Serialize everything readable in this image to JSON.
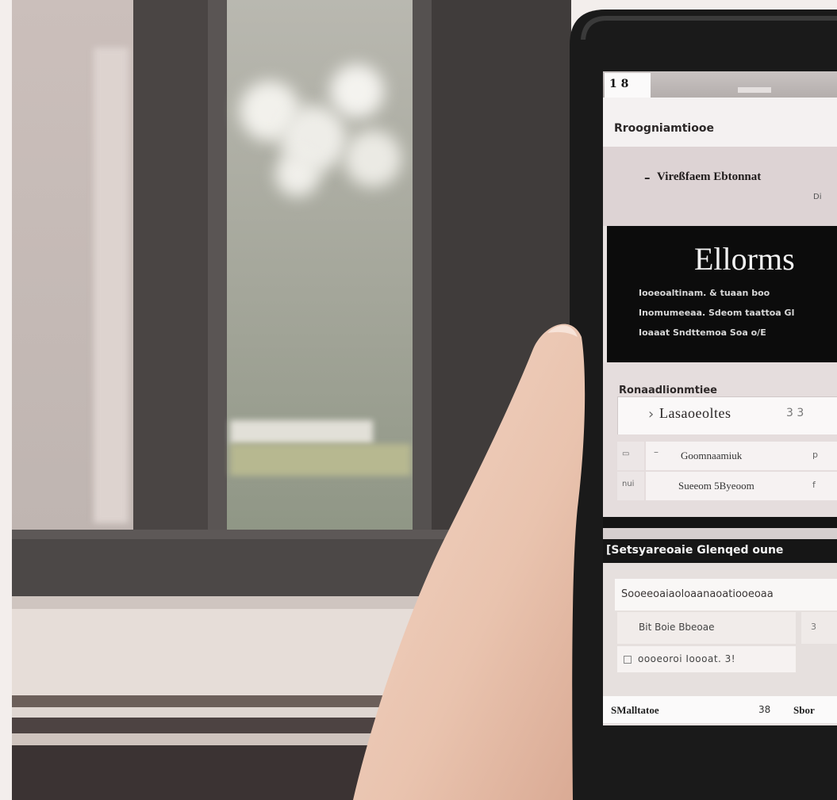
{
  "status_bar": {
    "left": "1 8"
  },
  "header": {
    "title": "Rroogniamtiooe"
  },
  "subheader": {
    "arrow": "–",
    "text": "Vireßfaem Ebtonnat",
    "corner": "Di"
  },
  "banner": {
    "title": "Ellorms",
    "lines": [
      "Iooeoaltinam. & tuaan boo",
      "Inomumeeaa. Sdeom taattoa Gl",
      "Ioaaat Sndttemoa Soa o/E"
    ]
  },
  "section": {
    "label": "Ronaadlionmtiee",
    "input": {
      "icon": "chevron-right-icon",
      "prefix": "›",
      "value": "Lasaoeoltes",
      "suffix": "3  3"
    },
    "rows": [
      {
        "left": "▭",
        "mark": "–",
        "text": "Goomnaamiuk",
        "right": "p"
      },
      {
        "left": "nui",
        "mark": "",
        "text": "Sueeom 5Byeoom",
        "right": "f"
      }
    ]
  },
  "dark_header": {
    "text": "[Setsyareoaie Glenqed oune"
  },
  "form": {
    "input_value": "Sooeeoaiaoloaanaoatiooeoaa",
    "button_label": "Bit Boie Bbeoae",
    "side_value": "3",
    "check_label": "oooeoroi Ioooat. 3!"
  },
  "bottom_bar": {
    "left": "SMalltatoe",
    "count": "38",
    "right": "Sbor"
  },
  "colors": {
    "screen_bg": "#e8e2e1",
    "banner_bg": "#0c0c0c",
    "skin": "#e9c3ae",
    "phone": "#1a1a1a"
  }
}
